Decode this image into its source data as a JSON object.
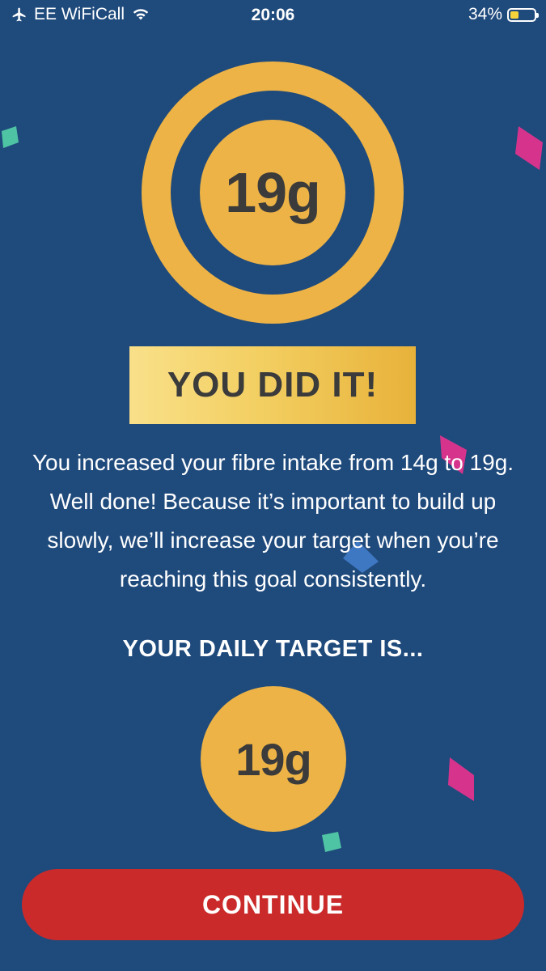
{
  "status_bar": {
    "carrier": "EE WiFiCall",
    "time": "20:06",
    "battery_percent": "34%",
    "battery_level": 0.34,
    "icons": [
      "airplane-icon",
      "wifi-icon",
      "battery-icon"
    ]
  },
  "achievement": {
    "value": "19g",
    "banner": "YOU DID IT!",
    "message": "You increased your fibre intake from 14g to 19g. Well done! Because it’s important to build up slowly, we’ll increase your target when you’re reaching this goal consistently."
  },
  "target": {
    "heading": "YOUR DAILY TARGET IS...",
    "value": "19g"
  },
  "actions": {
    "continue_label": "CONTINUE"
  },
  "colors": {
    "background": "#1f4a7c",
    "gold": "#edb346",
    "continue_button": "#cb2a2a",
    "confetti_pink": "#d6348c",
    "confetti_teal": "#4fc4a4",
    "confetti_blue": "#3f78c2"
  }
}
